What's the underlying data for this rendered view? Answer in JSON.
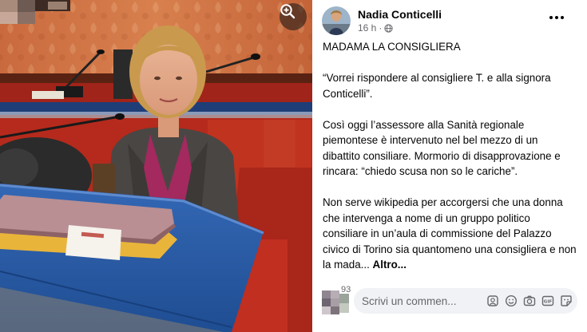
{
  "post": {
    "author": "Nadia Conticelli",
    "time": "16 h",
    "separator": "·",
    "paragraphs": [
      "MADAMA LA CONSIGLIERA",
      "“Vorrei rispondere al consigliere T. e alla signora Conticelli”.",
      "Così oggi l’assessore alla Sanità regionale piemontese è intervenuto nel bel mezzo di un dibattito consiliare. Mormorio di disapprovazione e rincara: “chiedo scusa non so le cariche”.",
      "Non serve wikipedia per accorgersi che una donna che intervenga a nome di un gruppo politico consiliare in un’aula di commissione del Palazzo civico di Torino sia quantomeno una consigliera e non la mada..."
    ],
    "more_label": "Altro..."
  },
  "comments": {
    "count": "93",
    "placeholder": "Scrivi un commen..."
  },
  "icons": {
    "zoom": "zoom-in-icon",
    "privacy": "globe-icon",
    "more": "more-options-icon",
    "comment_icons": [
      "avatar-sticker-icon",
      "emoji-icon",
      "camera-icon",
      "gif-icon",
      "sticker-icon"
    ]
  },
  "colors": {
    "text": "#050505",
    "secondary": "#65676b",
    "input_bg": "#f0f2f5",
    "desk_blue": "#2a5ca8",
    "chair_red": "#b52a1c"
  }
}
